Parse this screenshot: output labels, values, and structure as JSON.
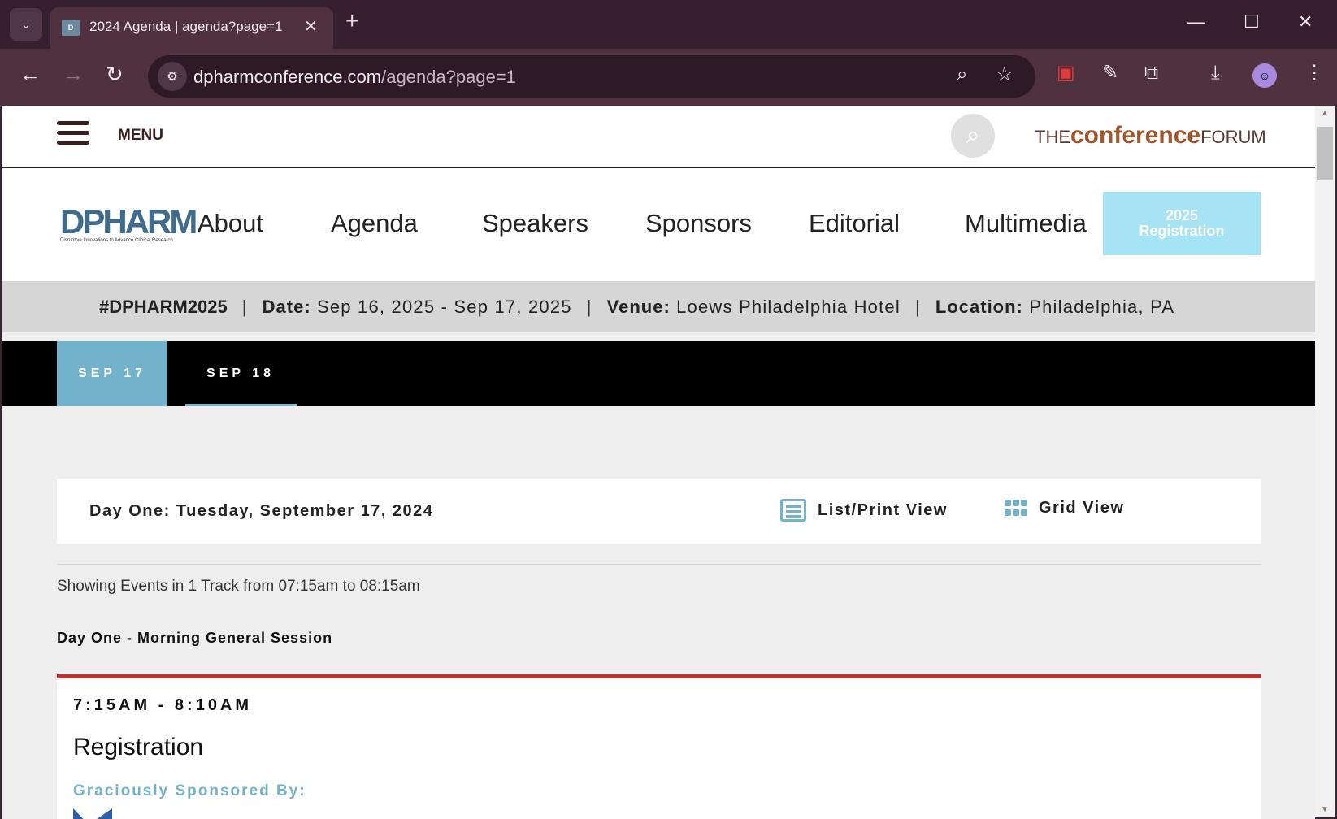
{
  "browser": {
    "tab_title": "2024 Agenda | agenda?page=1",
    "url_host": "dpharmconference.com",
    "url_path": "/agenda?page=1"
  },
  "site": {
    "menu_label": "MENU",
    "brand_logo_text": "THEconferenceFORUM",
    "dpharm_logo": "DPHARM",
    "dpharm_tagline": "Disruptive Innovations to Advance Clinical Research",
    "nav": [
      "About",
      "Agenda",
      "Speakers",
      "Sponsors",
      "Editorial",
      "Multimedia"
    ],
    "registration_line1": "2025",
    "registration_line2": "Registration",
    "accent_color": "#72b2cb",
    "registration_color": "#a6e3f5",
    "session_border_color": "#c0322b"
  },
  "infobar": {
    "hashtag": "#DPHARM2025",
    "date_label": "Date:",
    "date_value": "Sep 16, 2025 - Sep 17, 2025",
    "venue_label": "Venue:",
    "venue_value": "Loews Philadelphia Hotel",
    "location_label": "Location:",
    "location_value": "Philadelphia, PA"
  },
  "date_tabs": [
    "SEP 17",
    "SEP 18"
  ],
  "agenda": {
    "day_title": "Day One: Tuesday, September 17, 2024",
    "list_view_label": "List/Print View",
    "grid_view_label": "Grid View",
    "showing_text": "Showing Events in 1 Track from 07:15am to 08:15am",
    "session_title": "Day One - Morning General Session",
    "event": {
      "time": "7:15AM - 8:10AM",
      "name": "Registration",
      "sponsor_label": "Graciously Sponsored By:"
    }
  }
}
